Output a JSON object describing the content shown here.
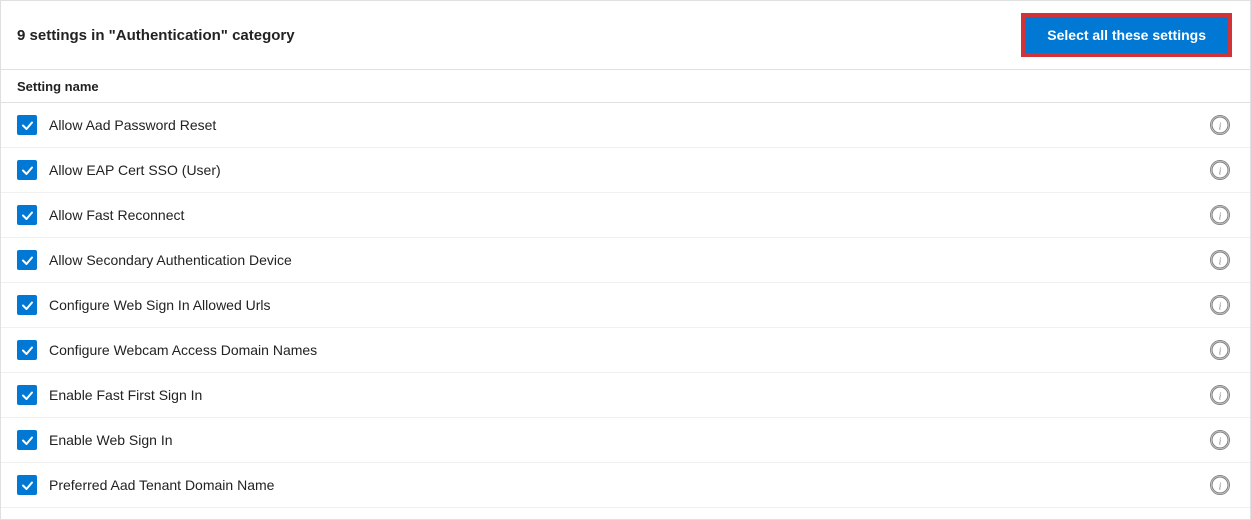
{
  "header": {
    "title": "9 settings in \"Authentication\" category",
    "select_all_label": "Select all these settings"
  },
  "column_header": {
    "setting_name": "Setting name"
  },
  "settings": [
    {
      "id": 1,
      "label": "Allow Aad Password Reset",
      "checked": true
    },
    {
      "id": 2,
      "label": "Allow EAP Cert SSO (User)",
      "checked": true
    },
    {
      "id": 3,
      "label": "Allow Fast Reconnect",
      "checked": true
    },
    {
      "id": 4,
      "label": "Allow Secondary Authentication Device",
      "checked": true
    },
    {
      "id": 5,
      "label": "Configure Web Sign In Allowed Urls",
      "checked": true
    },
    {
      "id": 6,
      "label": "Configure Webcam Access Domain Names",
      "checked": true
    },
    {
      "id": 7,
      "label": "Enable Fast First Sign In",
      "checked": true
    },
    {
      "id": 8,
      "label": "Enable Web Sign In",
      "checked": true
    },
    {
      "id": 9,
      "label": "Preferred Aad Tenant Domain Name",
      "checked": true
    }
  ],
  "colors": {
    "checkbox_bg": "#0078d4",
    "button_bg": "#0078d4",
    "button_border": "#d13438"
  }
}
